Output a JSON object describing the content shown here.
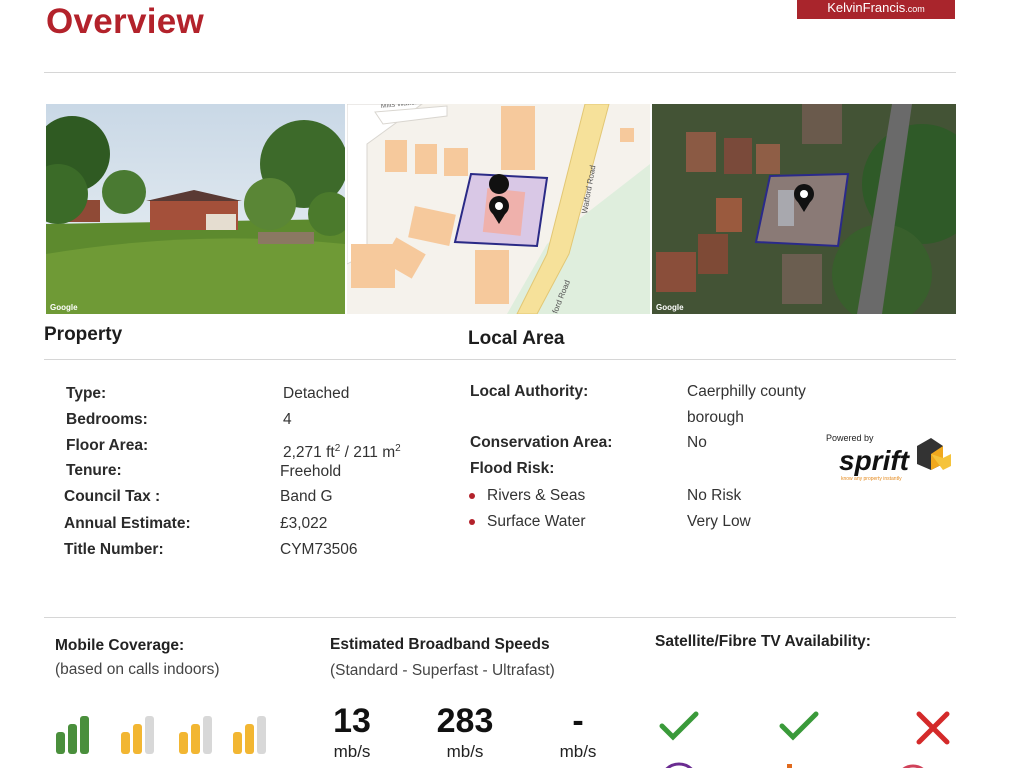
{
  "header": {
    "title": "Overview",
    "brand_name": "KelvinFrancis",
    "brand_tld": ".com"
  },
  "images": {
    "google_watermark": "Google",
    "map_street_top": "Milts Watford",
    "map_street_right": "Watford Road",
    "map_street_bottom": "ford Road",
    "marker_icon": "map-pin-icon"
  },
  "property": {
    "heading": "Property",
    "rows": [
      {
        "label": "Type:",
        "value": "Detached"
      },
      {
        "label": "Bedrooms:",
        "value": "4"
      },
      {
        "label": "Floor Area:",
        "value": "2,271 ft² / 211 m²"
      },
      {
        "label": "Tenure:",
        "value": "Freehold"
      },
      {
        "label": "Council Tax :",
        "value": "Band G"
      },
      {
        "label": "Annual Estimate:",
        "value": "£3,022"
      },
      {
        "label": "Title Number:",
        "value": "CYM73506"
      }
    ]
  },
  "local_area": {
    "heading": "Local Area",
    "local_authority_label": "Local Authority:",
    "local_authority_line1": "Caerphilly county",
    "local_authority_line2": "borough",
    "conservation_label": "Conservation Area:",
    "conservation_value": "No",
    "flood_label": "Flood Risk:",
    "flood_rows": [
      {
        "label": "Rivers & Seas",
        "value": "No Risk"
      },
      {
        "label": "Surface Water",
        "value": "Very Low"
      }
    ],
    "powered_by": "Powered by",
    "sprift_name": "sprift",
    "sprift_tagline": "know any property instantly"
  },
  "mobile": {
    "label": "Mobile Coverage:",
    "sub": "(based on calls indoors)",
    "signal_levels": [
      4,
      2,
      2,
      2
    ],
    "colors": {
      "good": "#4a8f3c",
      "ok": "#f2b632",
      "empty": "#d8d8d8"
    }
  },
  "broadband": {
    "label": "Estimated Broadband Speeds",
    "sub": "(Standard - Superfast - Ultrafast)",
    "speeds": [
      {
        "value": "13",
        "unit": "mb/s"
      },
      {
        "value": "283",
        "unit": "mb/s"
      },
      {
        "value": "-",
        "unit": "mb/s"
      }
    ]
  },
  "tv": {
    "label": "Satellite/Fibre TV Availability:",
    "availability": [
      {
        "icon": "check-icon",
        "available": true
      },
      {
        "icon": "check-icon",
        "available": true
      },
      {
        "icon": "cross-icon",
        "available": false
      }
    ],
    "colors": {
      "check": "#3a9a3a",
      "cross": "#d42a2a"
    }
  }
}
